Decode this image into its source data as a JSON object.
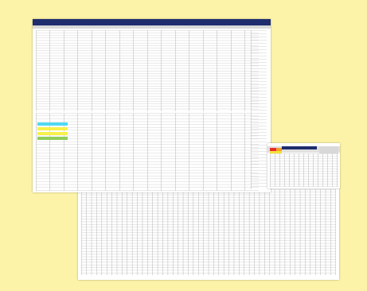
{
  "main_sheet": {
    "title": "",
    "legend_title": "",
    "group_labels": [
      "",
      "",
      "",
      ""
    ],
    "side_labels": [
      "",
      "",
      ""
    ],
    "bottom_labels": [
      "",
      "",
      ""
    ],
    "colors": {
      "title_bar": "#1f2d6e",
      "swatches": [
        "#4fd9f2",
        "#f7f14b",
        "#f7f14b",
        "#8fce5a"
      ]
    }
  },
  "side_sheet": {
    "title": "",
    "colors": {
      "header": "#1f2d6e",
      "red": "#e52d2d",
      "orange": "#f2a12b",
      "yellow": "#f5e23b"
    }
  },
  "back_sheet": {
    "rows": []
  }
}
